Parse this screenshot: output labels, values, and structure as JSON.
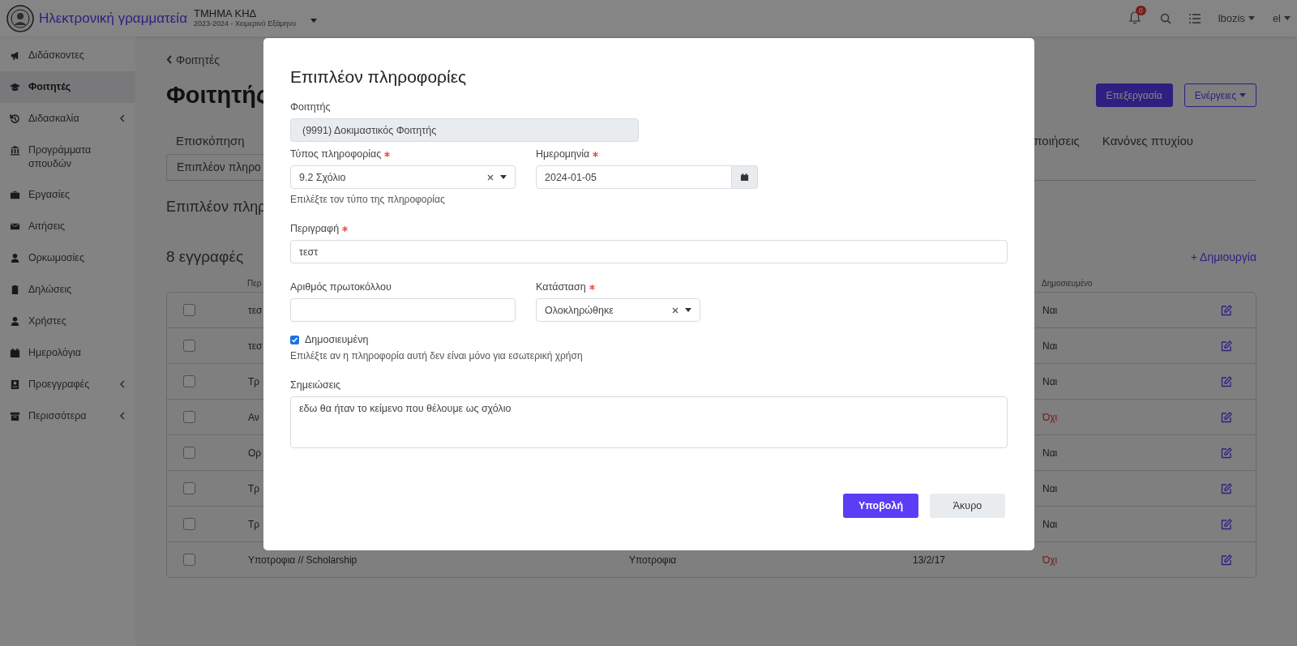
{
  "header": {
    "app_title": "Ηλεκτρονική γραμματεία",
    "department": "ΤΜΗΜΑ ΚΗΔ",
    "semester": "2023-2024 - Χειμερινό Εξάμηνο",
    "notifications_badge": "0",
    "user": "lbozis",
    "language": "el"
  },
  "sidebar": {
    "items": [
      {
        "label": "Διδάσκοντες",
        "selected": false,
        "expandable": false
      },
      {
        "label": "Φοιτητές",
        "selected": true,
        "expandable": false
      },
      {
        "label": "Διδασκαλία",
        "selected": false,
        "expandable": true
      },
      {
        "label": "Προγράμματα σπουδών",
        "selected": false,
        "expandable": false
      },
      {
        "label": "Εργασίες",
        "selected": false,
        "expandable": false
      },
      {
        "label": "Αιτήσεις",
        "selected": false,
        "expandable": false
      },
      {
        "label": "Ορκωμοσίες",
        "selected": false,
        "expandable": false
      },
      {
        "label": "Δηλώσεις",
        "selected": false,
        "expandable": false
      },
      {
        "label": "Χρήστες",
        "selected": false,
        "expandable": false
      },
      {
        "label": "Ημερολόγια",
        "selected": false,
        "expandable": false
      },
      {
        "label": "Προεγγραφές",
        "selected": false,
        "expandable": true
      },
      {
        "label": "Περισσότερα",
        "selected": false,
        "expandable": true
      }
    ]
  },
  "page": {
    "back_link": "Φοιτητές",
    "title": "Φοιτητής",
    "buttons": [
      {
        "label": "Επεξεργασία",
        "kind": "primary"
      },
      {
        "label": "Ενέργειες",
        "kind": "dropdown"
      }
    ],
    "tabs": [
      {
        "label": "Επισκόπηση",
        "selected": false
      },
      {
        "label": "ποιήσεις",
        "selected": false
      },
      {
        "label": "Κανόνες πτυχίου",
        "selected": false
      }
    ],
    "subtabs": [
      {
        "label": "Επιπλέον πληρο",
        "selected": true
      }
    ],
    "section_title": "Επιπλέον πληρ",
    "record_count": "8 εγγραφές",
    "create_link": "+ Δημιουργία",
    "table": {
      "column_1": "Περ",
      "column_4": "Δημοσιευμένο",
      "rows": [
        {
          "checked": false,
          "column_1": "τεσ",
          "published": true,
          "published_label": "Ναι"
        },
        {
          "checked": false,
          "column_1": "τεσ",
          "published": true,
          "published_label": "Ναι"
        },
        {
          "checked": false,
          "column_1": "Τρ",
          "published": true,
          "published_label": "Ναι"
        },
        {
          "checked": false,
          "column_1": "Αν",
          "published": false,
          "published_label": "Όχι"
        },
        {
          "checked": false,
          "column_1": "Ορ",
          "published": true,
          "published_label": "Ναι"
        },
        {
          "checked": false,
          "column_1": "Τρ",
          "published": true,
          "published_label": "Ναι"
        },
        {
          "checked": false,
          "column_1": "Τρ",
          "published": true,
          "published_label": "Ναι"
        },
        {
          "checked": false,
          "column_1": "Υποτροφια // Scholarship",
          "column_2": "Υποτροφια",
          "column_3": "13/2/17",
          "published": false,
          "published_label": "Όχι"
        }
      ]
    }
  },
  "modal": {
    "title": "Επιπλέον πληροφορίες",
    "student": {
      "label": "Φοιτητής",
      "value": "(9991) Δοκιμαστικός Φοιτητής"
    },
    "info_type": {
      "label": "Τύπος πληροφορίας",
      "required": true,
      "value": "9.2 Σχόλιο",
      "help": "Επιλέξτε τον τύπο της πληροφορίας"
    },
    "date": {
      "label": "Ημερομηνία",
      "required": true,
      "value": "2024-01-05"
    },
    "description": {
      "label": "Περιγραφή",
      "required": true,
      "value": "τεστ"
    },
    "protocol": {
      "label": "Αριθμός πρωτοκόλλου",
      "required": false
    },
    "status": {
      "label": "Κατάσταση",
      "required": true,
      "value": "Ολοκληρώθηκε"
    },
    "published": {
      "label": "Δημοσιευμένη",
      "checked": true,
      "help": "Επιλέξτε αν η πληροφορία αυτή δεν είναι μόνο για εσωτερική χρήση"
    },
    "notes": {
      "label": "Σημειώσεις",
      "value": "εδω θα ήταν το κείμενο που θέλουμε ως σχόλιο"
    },
    "buttons": [
      {
        "label": "Υποβολή",
        "kind": "primary"
      },
      {
        "label": "Άκυρο",
        "kind": "secondary"
      }
    ]
  }
}
